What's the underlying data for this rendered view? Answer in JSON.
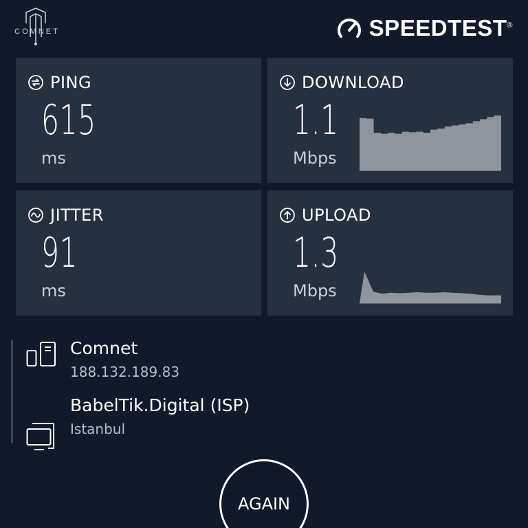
{
  "header": {
    "brand_name": "COMNET",
    "app_logo_text": "SPEEDTEST",
    "app_logo_mark": "®",
    "gauge_icon": "speedometer-icon"
  },
  "metrics": {
    "ping": {
      "label": "PING",
      "value": "615",
      "unit": "ms",
      "icon": "ping-icon"
    },
    "download": {
      "label": "DOWNLOAD",
      "value": "1.1",
      "unit": "Mbps",
      "icon": "download-arrow-icon",
      "graph_trend": [
        1.0,
        0.99,
        0.72,
        0.7,
        0.72,
        0.7,
        0.74,
        0.73,
        0.74,
        0.72,
        0.78,
        0.8,
        0.84,
        0.86,
        0.88,
        0.9,
        0.94,
        0.98,
        1.02,
        1.05
      ]
    },
    "jitter": {
      "label": "JITTER",
      "value": "91",
      "unit": "ms",
      "icon": "jitter-wave-icon"
    },
    "upload": {
      "label": "UPLOAD",
      "value": "1.3",
      "unit": "Mbps",
      "icon": "upload-arrow-icon",
      "graph_trend": [
        0,
        0.6,
        0.22,
        0.18,
        0.2,
        0.19,
        0.2,
        0.21,
        0.2,
        0.2,
        0.21,
        0.2,
        0.19,
        0.18,
        0.16,
        0.15
      ]
    }
  },
  "server": {
    "name": "Comnet",
    "ip": "188.132.189.83",
    "icon": "server-icon"
  },
  "isp": {
    "name": "BabelTik.Digital (ISP)",
    "location": "Istanbul",
    "icon": "computer-icon"
  },
  "actions": {
    "again_label": "AGAIN"
  },
  "colors": {
    "background": "#111a2a",
    "tile": "#26313f",
    "graph_fill": "#8e959c",
    "text_primary": "#ffffff",
    "text_secondary": "#b5bec8"
  }
}
